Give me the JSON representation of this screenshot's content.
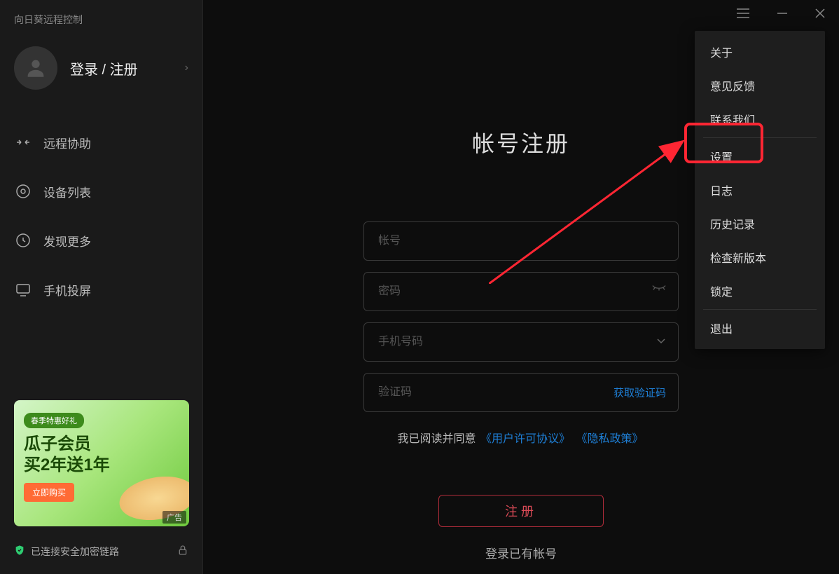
{
  "app": {
    "title": "向日葵远程控制"
  },
  "user": {
    "login_register": "登录 / 注册"
  },
  "nav": {
    "remote_assist": "远程协助",
    "device_list": "设备列表",
    "discover_more": "发现更多",
    "phone_cast": "手机投屏"
  },
  "promo": {
    "badge": "春季特惠好礼",
    "line1": "瓜子会员",
    "line2": "买2年送1年",
    "buy": "立即购买",
    "ad": "广告"
  },
  "status": {
    "text": "已连接安全加密链路"
  },
  "form": {
    "title": "帐号注册",
    "account_ph": "帐号",
    "password_ph": "密码",
    "phone_ph": "手机号码",
    "code_ph": "验证码",
    "get_code": "获取验证码",
    "agree_prefix": "我已阅读并同意",
    "eula": "《用户许可协议》",
    "privacy": "《隐私政策》",
    "register": "注册",
    "login_existing": "登录已有帐号"
  },
  "menu": {
    "about": "关于",
    "feedback": "意见反馈",
    "contact": "联系我们",
    "settings": "设置",
    "log": "日志",
    "history": "历史记录",
    "check_update": "检查新版本",
    "lock": "锁定",
    "exit": "退出"
  }
}
